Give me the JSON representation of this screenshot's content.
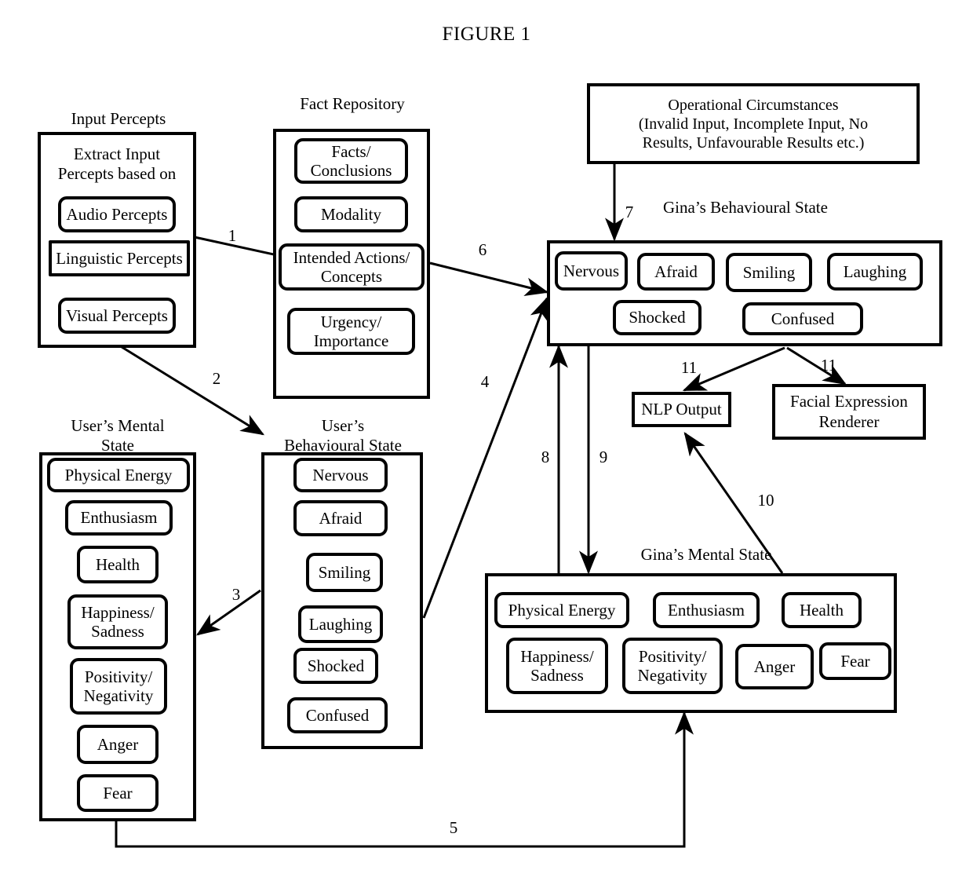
{
  "figure": {
    "title": "FIGURE 1"
  },
  "captions": {
    "input_percepts": "Input Percepts",
    "fact_repository": "Fact Repository",
    "gina_behavioural_state": "Gina’s Behavioural State",
    "users_mental_state": "User’s Mental\nState",
    "users_behavioural_state": "User’s\nBehavioural State",
    "ginas_mental_state": "Gina’s Mental State"
  },
  "input_percepts": {
    "heading": "Extract Input\nPercepts based on",
    "items": [
      {
        "label": "Audio Percepts"
      },
      {
        "label": "Linguistic Percepts"
      },
      {
        "label": "Visual Percepts"
      }
    ]
  },
  "fact_repository": {
    "items": [
      {
        "label": "Facts/\nConclusions"
      },
      {
        "label": "Modality"
      },
      {
        "label": "Intended Actions/\nConcepts"
      },
      {
        "label": "Urgency/\nImportance"
      }
    ]
  },
  "operational_circumstances": {
    "label": "Operational Circumstances\n(Invalid Input, Incomplete Input, No\nResults, Unfavourable Results etc.)"
  },
  "gina_behavioural_state": {
    "items": [
      {
        "label": "Nervous"
      },
      {
        "label": "Afraid"
      },
      {
        "label": "Smiling"
      },
      {
        "label": "Laughing"
      },
      {
        "label": "Shocked"
      },
      {
        "label": "Confused"
      }
    ]
  },
  "outputs": {
    "nlp_output": "NLP Output",
    "facial_expression_renderer": "Facial Expression\nRenderer"
  },
  "users_mental_state": {
    "items": [
      {
        "label": "Physical Energy"
      },
      {
        "label": "Enthusiasm"
      },
      {
        "label": "Health"
      },
      {
        "label": "Happiness/\nSadness"
      },
      {
        "label": "Positivity/\nNegativity"
      },
      {
        "label": "Anger"
      },
      {
        "label": "Fear"
      }
    ]
  },
  "users_behavioural_state": {
    "items": [
      {
        "label": "Nervous"
      },
      {
        "label": "Afraid"
      },
      {
        "label": "Smiling"
      },
      {
        "label": "Laughing"
      },
      {
        "label": "Shocked"
      },
      {
        "label": "Confused"
      }
    ]
  },
  "ginas_mental_state": {
    "items": [
      {
        "label": "Physical Energy"
      },
      {
        "label": "Enthusiasm"
      },
      {
        "label": "Health"
      },
      {
        "label": "Happiness/\nSadness"
      },
      {
        "label": "Positivity/\nNegativity"
      },
      {
        "label": "Anger"
      },
      {
        "label": "Fear"
      }
    ]
  },
  "connectors": [
    {
      "id": "1",
      "label": "1"
    },
    {
      "id": "2",
      "label": "2"
    },
    {
      "id": "3",
      "label": "3"
    },
    {
      "id": "4",
      "label": "4"
    },
    {
      "id": "5",
      "label": "5"
    },
    {
      "id": "6",
      "label": "6"
    },
    {
      "id": "7",
      "label": "7"
    },
    {
      "id": "8",
      "label": "8"
    },
    {
      "id": "9",
      "label": "9"
    },
    {
      "id": "10",
      "label": "10"
    },
    {
      "id": "11a",
      "label": "11"
    },
    {
      "id": "11b",
      "label": "11"
    }
  ],
  "colors": {
    "stroke": "#000000",
    "background": "#ffffff"
  }
}
